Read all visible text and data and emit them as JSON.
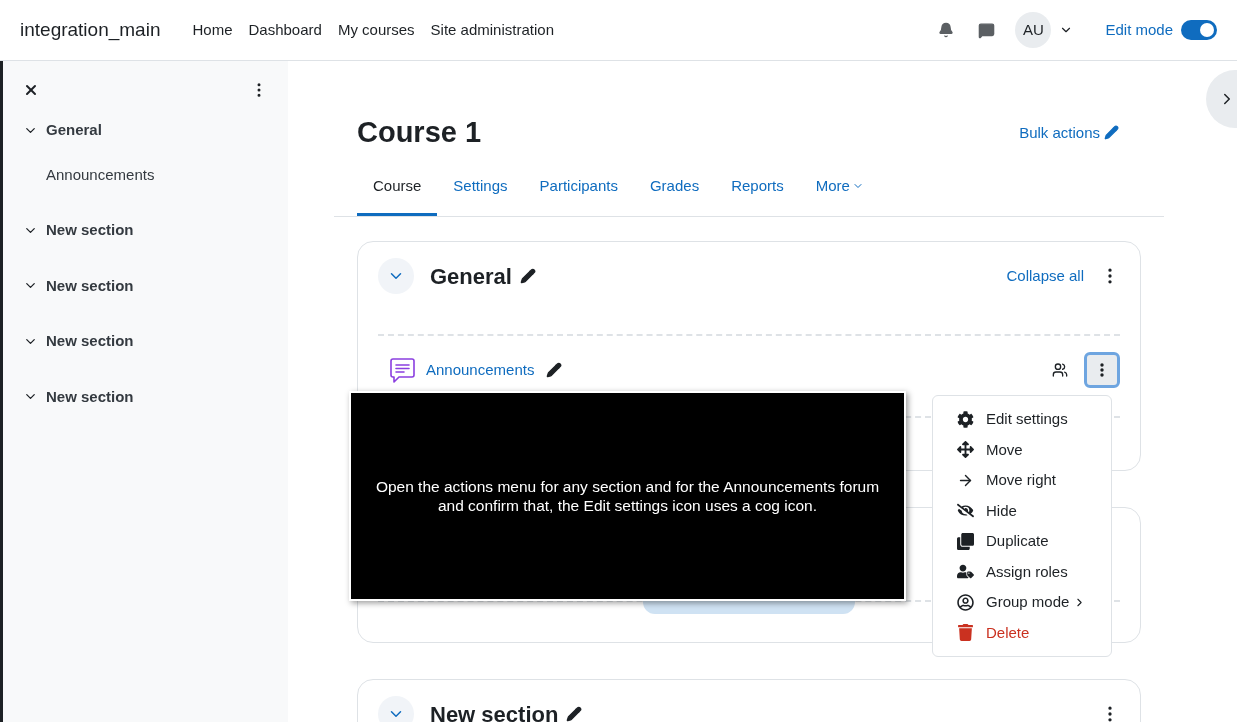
{
  "navbar": {
    "site_name": "integration_main",
    "links": [
      "Home",
      "Dashboard",
      "My courses",
      "Site administration"
    ],
    "avatar": "AU",
    "edit_mode": {
      "label": "Edit mode",
      "on": true
    }
  },
  "sidebar": {
    "items": [
      {
        "label": "General",
        "expanded": true,
        "children": [
          {
            "label": "Announcements"
          }
        ]
      },
      {
        "label": "New section",
        "expanded": true
      },
      {
        "label": "New section",
        "expanded": true
      },
      {
        "label": "New section",
        "expanded": true
      },
      {
        "label": "New section",
        "expanded": true
      }
    ]
  },
  "course": {
    "title": "Course 1",
    "bulk_actions": "Bulk actions",
    "tabs": [
      {
        "label": "Course",
        "selected": true
      },
      {
        "label": "Settings",
        "selected": false
      },
      {
        "label": "Participants",
        "selected": false
      },
      {
        "label": "Grades",
        "selected": false
      },
      {
        "label": "Reports",
        "selected": false
      },
      {
        "label": "More",
        "selected": false
      }
    ]
  },
  "sections": [
    {
      "kind": "open",
      "title": "General",
      "expanded": true,
      "collapse_all": "Collapse all",
      "activities": [
        {
          "name": "Announcements"
        }
      ]
    },
    {
      "kind": "covered"
    },
    {
      "kind": "open",
      "title": "New section",
      "expanded": true
    }
  ],
  "actions_menu": {
    "items": [
      {
        "label": "Edit settings",
        "kind": "normal"
      },
      {
        "label": "Move",
        "kind": "normal"
      },
      {
        "label": "Move right",
        "kind": "normal"
      },
      {
        "label": "Hide",
        "kind": "normal"
      },
      {
        "label": "Duplicate",
        "kind": "normal"
      },
      {
        "label": "Assign roles",
        "kind": "normal"
      },
      {
        "label": "Group mode",
        "kind": "submenu"
      },
      {
        "label": "Delete",
        "kind": "danger"
      }
    ]
  },
  "instruction": {
    "text": "Open the actions menu for any section and for the Announcements forum and confirm that, the Edit settings icon uses a cog icon."
  }
}
